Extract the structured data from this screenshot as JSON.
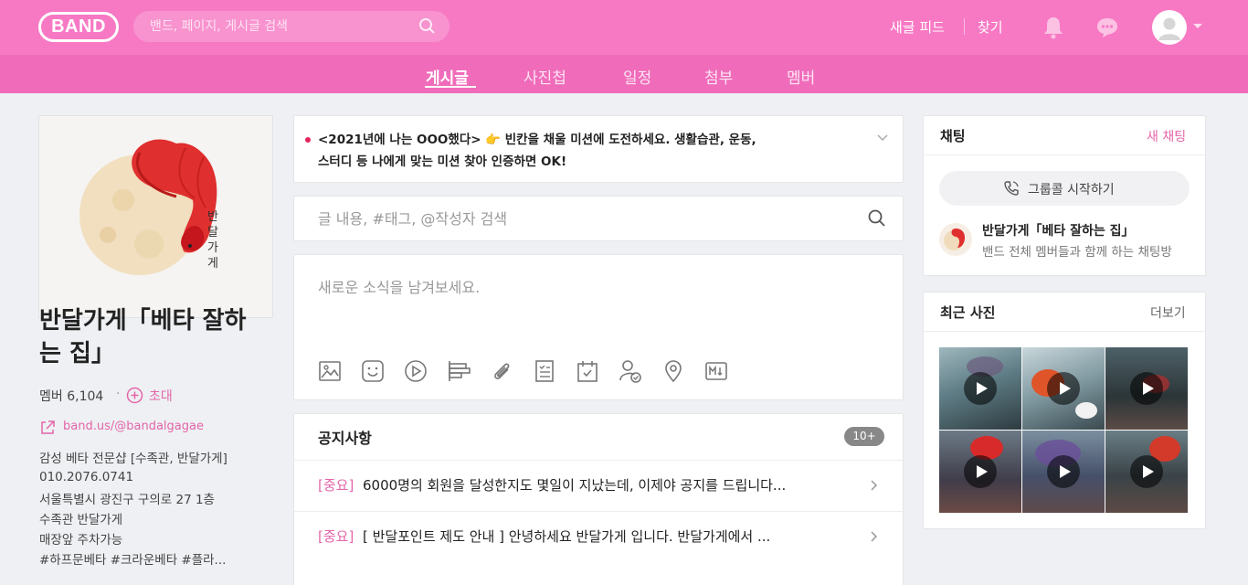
{
  "header": {
    "logo": "BAND",
    "search_placeholder": "밴드, 페이지, 게시글 검색",
    "links": [
      "새글 피드",
      "찾기"
    ]
  },
  "tabs": [
    {
      "label": "게시글",
      "active": true
    },
    {
      "label": "사진첩",
      "active": false
    },
    {
      "label": "일정",
      "active": false
    },
    {
      "label": "첨부",
      "active": false
    },
    {
      "label": "멤버",
      "active": false
    }
  ],
  "band": {
    "name_line1": "반달가게「베타 잘하",
    "name_line2": "는 집」",
    "cover_caption": [
      "반",
      "달",
      "가",
      "게"
    ],
    "members": "멤버 6,104",
    "invite": "초대",
    "url": "band.us/@bandalgagae",
    "description": [
      "감성 베타 전문샵 [수족관, 반달가게]",
      "010.2076.0741",
      "서울특별시 광진구 구의로 27 1층",
      "수족관 반달가게",
      "매장앞 주차가능",
      "#하프문베타 #크라운베타 #플라..."
    ]
  },
  "mission": {
    "text_line1": "<2021년에 나는 OOO했다> 👉 빈칸을 채울 미션에 도전하세요. 생활습관, 운동,",
    "text_line2": "스터디 등 나에게 맞는 미션 찾아 인증하면 OK!"
  },
  "post_search": {
    "placeholder": "글 내용, #태그, @작성자 검색"
  },
  "compose": {
    "placeholder": "새로운 소식을 남겨보세요.",
    "tools": [
      "image-icon",
      "sticker-icon",
      "video-icon",
      "poll-icon",
      "attach-icon",
      "todo-icon",
      "calendar-icon",
      "member-check-icon",
      "location-icon",
      "markdown-icon"
    ]
  },
  "notice": {
    "title": "공지사항",
    "badge": "10+",
    "items": [
      {
        "tag": "[중요]",
        "text": "6000명의 회원을 달성한지도 몇일이 지났는데, 이제야 공지를 드립니다..."
      },
      {
        "tag": "[중요]",
        "text": "[ 반달포인트 제도 안내 ] 안녕하세요 반달가게 입니다. 반달가게에서 ..."
      }
    ]
  },
  "chat": {
    "title": "채팅",
    "new_chat": "새 채팅",
    "group_call": "그룹콜 시작하기",
    "room_name": "반달가게「베타 잘하는 집」",
    "room_desc": "밴드 전체 멤버들과 함께 하는 채팅방"
  },
  "photos": {
    "title": "최근 사진",
    "more": "더보기",
    "count": 6
  },
  "colors": {
    "brand": "#f779c4",
    "accent": "#e465a9"
  }
}
